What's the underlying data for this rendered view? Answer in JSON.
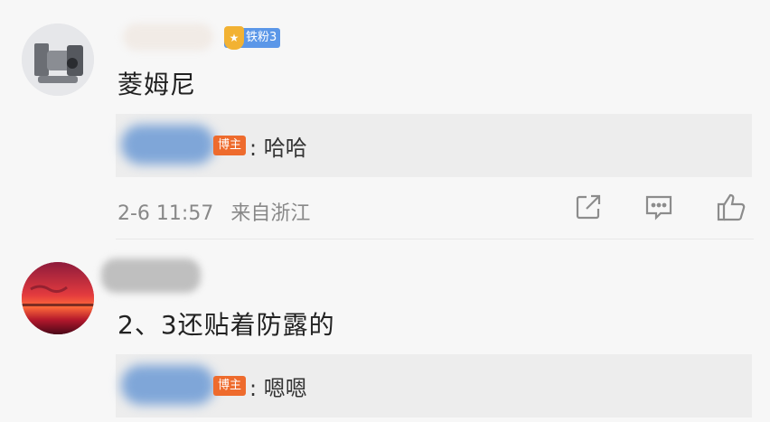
{
  "comments": [
    {
      "fan_badge": "铁粉3",
      "fan_badge_icon": "fan-medal-icon",
      "text": "菱姆尼",
      "reply": {
        "owner_badge": "博主",
        "text": ": 哈哈"
      },
      "date": "2-6 11:57",
      "location": "来自浙江"
    },
    {
      "text": "2、3还贴着防露的",
      "reply": {
        "owner_badge": "博主",
        "text": ": 嗯嗯"
      }
    }
  ],
  "colors": {
    "background": "#f7f7f7",
    "reply_box": "#ededed",
    "fan_badge": "#5b97e8",
    "owner_badge": "#ee6b2d",
    "meta_text": "#888888"
  }
}
